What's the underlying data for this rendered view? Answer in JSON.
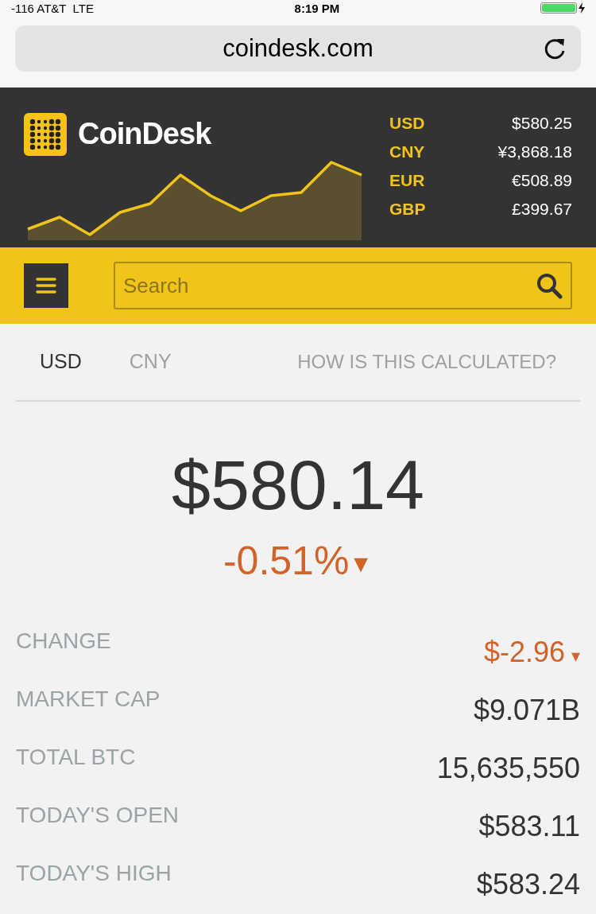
{
  "status_bar": {
    "carrier": "-116 AT&T",
    "network": "LTE",
    "time": "8:19 PM",
    "battery": {
      "level": 1,
      "charging": true
    }
  },
  "browser": {
    "url": "coindesk.com"
  },
  "header": {
    "logo": "CoinDesk",
    "rates": [
      {
        "currency": "USD",
        "value": "$580.25"
      },
      {
        "currency": "CNY",
        "value": "¥3,868.18"
      },
      {
        "currency": "EUR",
        "value": "€508.89"
      },
      {
        "currency": "GBP",
        "value": "£399.67"
      }
    ]
  },
  "search": {
    "placeholder": "Search"
  },
  "tabs": [
    {
      "label": "USD",
      "selected": true
    },
    {
      "label": "CNY",
      "selected": false
    }
  ],
  "help_link": "HOW IS THIS CALCULATED?",
  "price": "$580.14",
  "percent_change": {
    "value": "-0.51%",
    "arrow": "▼",
    "negative": true
  },
  "stats": [
    {
      "label": "CHANGE",
      "value": "$-2.96",
      "negative": true,
      "arrow": "▾"
    },
    {
      "label": "MARKET CAP",
      "value": "$9.071B",
      "negative": false
    },
    {
      "label": "TOTAL BTC",
      "value": "15,635,550",
      "negative": false
    },
    {
      "label": "TODAY'S OPEN",
      "value": "$583.11",
      "negative": false
    },
    {
      "label": "TODAY'S HIGH",
      "value": "$583.24",
      "negative": false
    }
  ]
}
